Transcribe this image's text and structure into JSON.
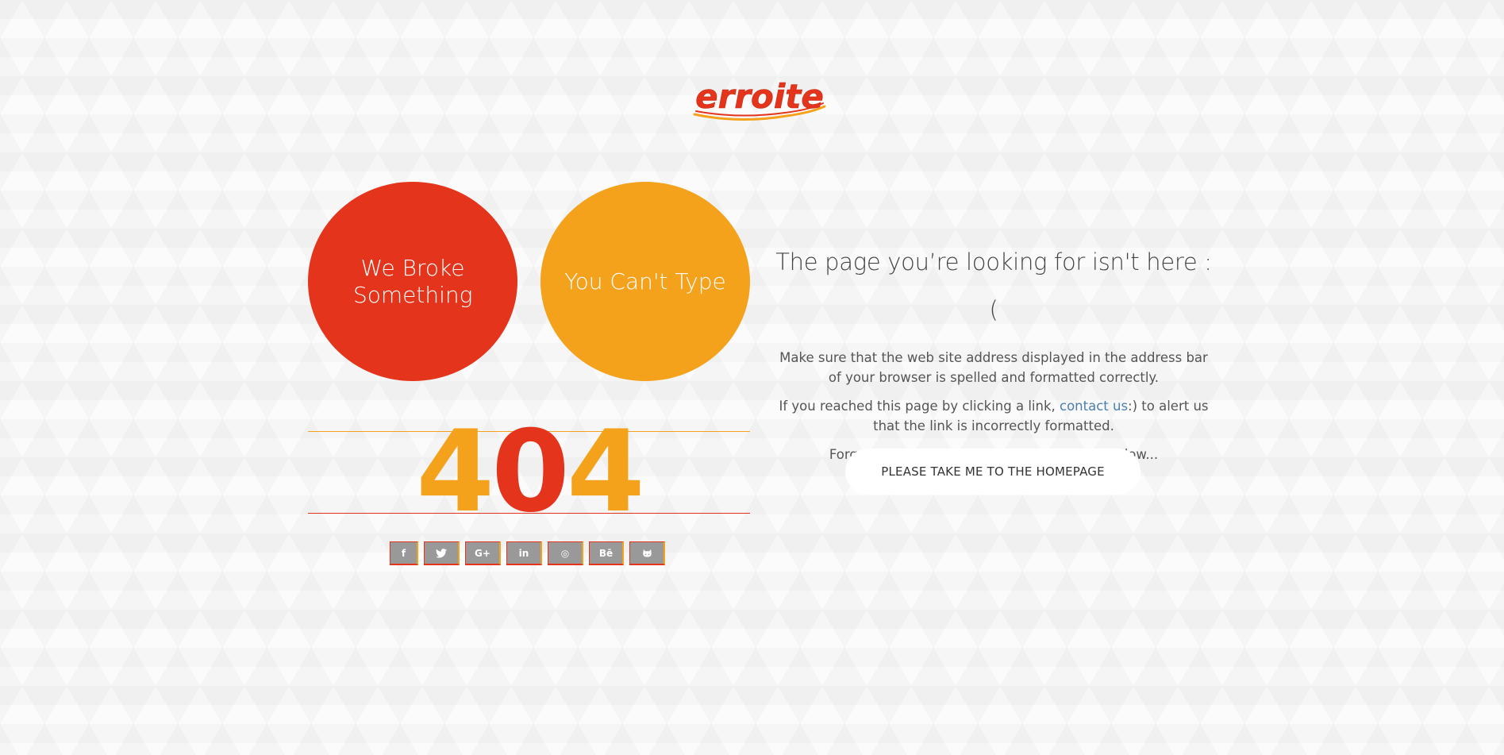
{
  "brand": {
    "logo_text": "erroite",
    "colors": {
      "red": "#e5341c",
      "orange": "#f4a11c",
      "link": "#4a7fb0"
    }
  },
  "circles": {
    "left_label": "We Broke Something",
    "right_label": "You Can't Type"
  },
  "error_code": {
    "digit_1": "4",
    "digit_2": "0",
    "digit_3": "4"
  },
  "socials": [
    {
      "icon": "facebook-icon",
      "glyph": "f"
    },
    {
      "icon": "twitter-icon",
      "glyph": "🐦"
    },
    {
      "icon": "google-plus-icon",
      "glyph": "G+"
    },
    {
      "icon": "linkedin-icon",
      "glyph": "in"
    },
    {
      "icon": "dribbble-icon",
      "glyph": "◎"
    },
    {
      "icon": "behance-icon",
      "glyph": "Bē"
    },
    {
      "icon": "github-icon",
      "glyph": "◕"
    }
  ],
  "message": {
    "heading": "The page you’re looking for isn't here :(",
    "para1": "Make sure that the web site address displayed in the address bar of your browser is spelled and formatted correctly.",
    "para2_before": "If you reached this page by clicking a link, ",
    "para2_link": "contact us",
    "para2_after": ":) to alert us that the link is incorrectly formatted.",
    "para3": "Forget that this ever happened, and go to below..."
  },
  "home_button": {
    "label": "PLEASE TAKE ME TO THE HOMEPAGE"
  }
}
